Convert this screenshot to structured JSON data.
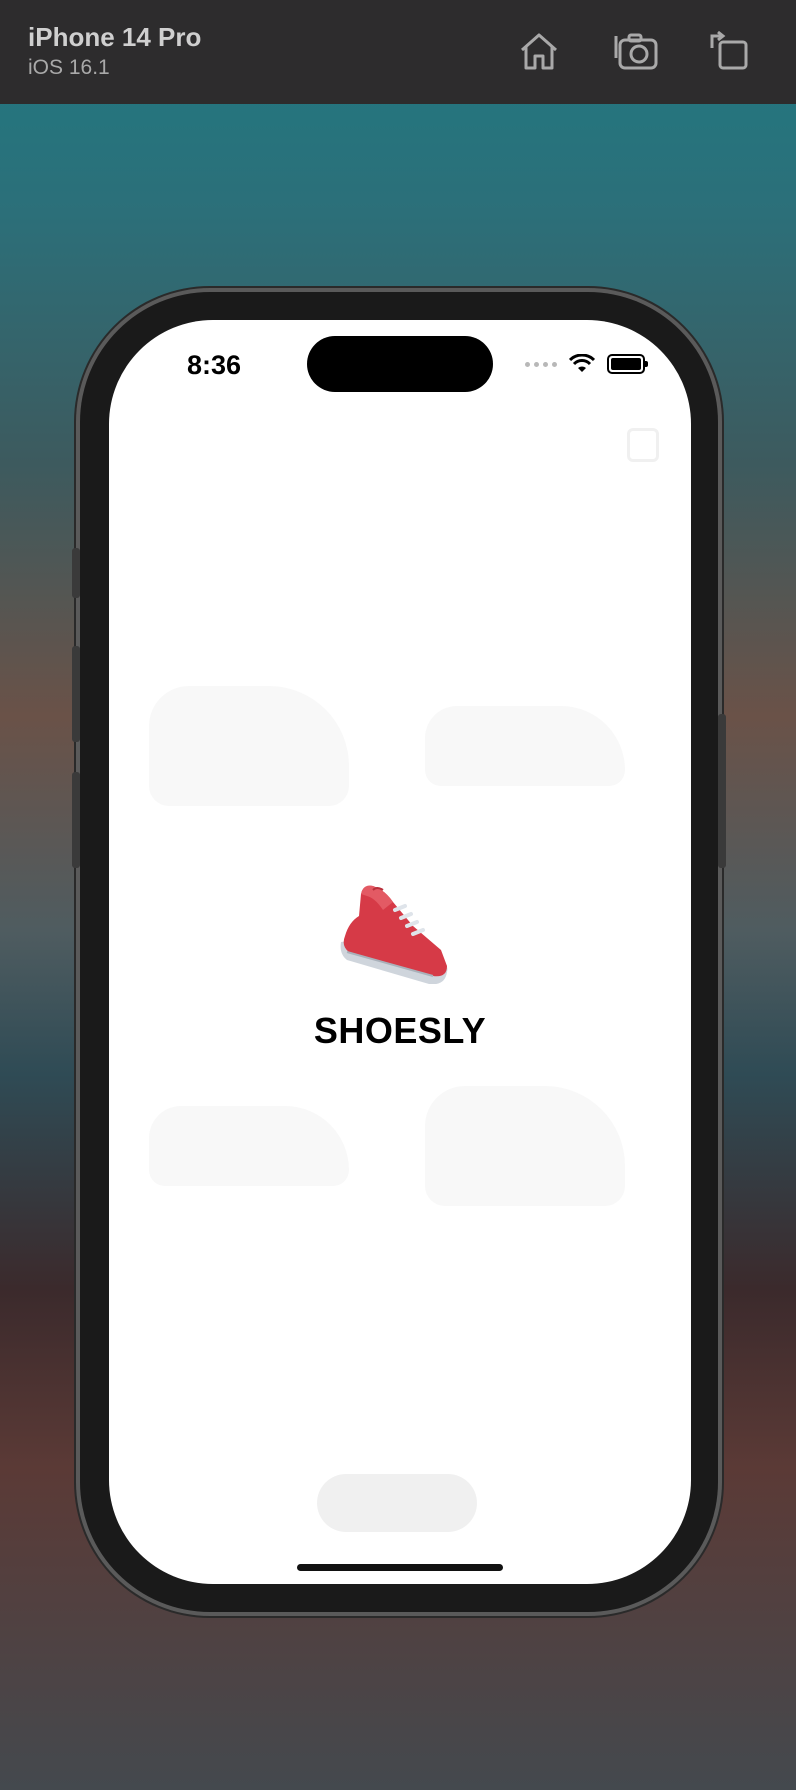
{
  "simulator": {
    "device_name": "iPhone 14 Pro",
    "os_version": "iOS 16.1",
    "toolbar_icons": [
      "home-icon",
      "screenshot-camera-icon",
      "rotate-device-icon"
    ]
  },
  "status_bar": {
    "time": "8:36",
    "icons": [
      "cellular-dots-icon",
      "wifi-icon",
      "battery-icon"
    ]
  },
  "splash": {
    "logo_icon": "sneaker-emoji-icon",
    "title": "SHOESLY"
  },
  "colors": {
    "simulator_bar": "#2d2c2d",
    "screen_bg": "#ffffff",
    "shoe_red": "#d63a47",
    "text": "#000000"
  }
}
